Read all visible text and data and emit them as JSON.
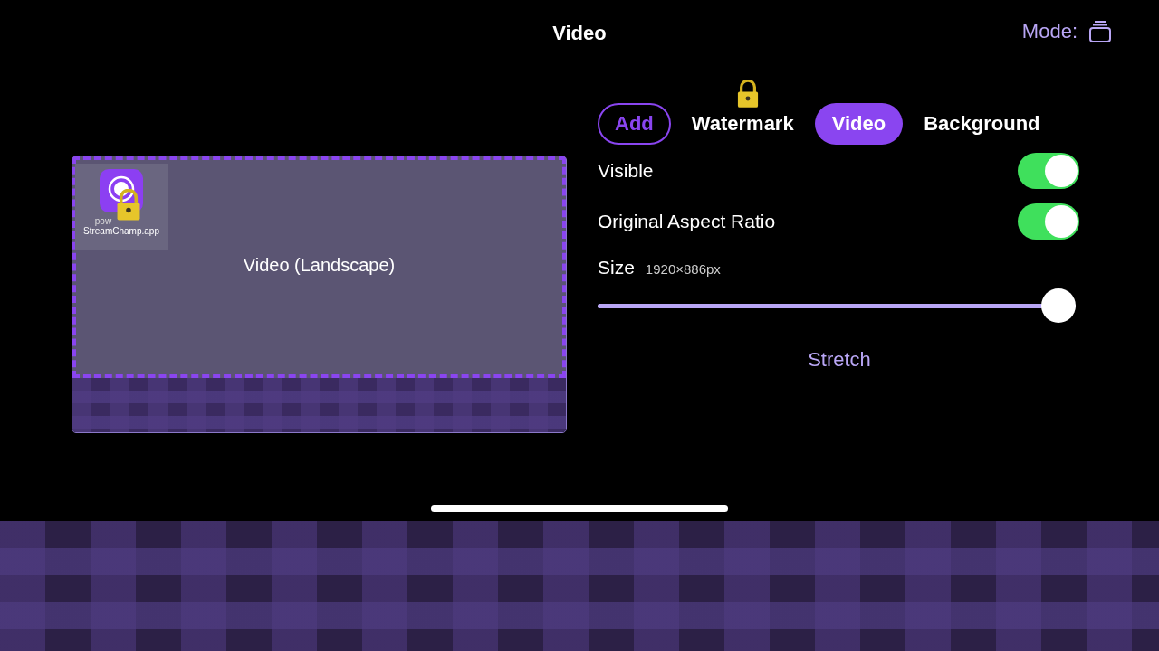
{
  "header": {
    "title": "Video",
    "mode_label": "Mode:"
  },
  "preview": {
    "label": "Video (Landscape)",
    "watermark": {
      "caption_start": "pow",
      "caption_end": "StreamChamp.app",
      "locked": true
    }
  },
  "tabs": [
    {
      "label": "Add",
      "kind": "outline",
      "selected": false,
      "locked": false
    },
    {
      "label": "Watermark",
      "kind": "plain",
      "selected": false,
      "locked": true
    },
    {
      "label": "Video",
      "kind": "plain",
      "selected": true,
      "locked": false
    },
    {
      "label": "Background",
      "kind": "plain",
      "selected": false,
      "locked": false
    }
  ],
  "settings": [
    {
      "label": "Visible",
      "on": true
    },
    {
      "label": "Original Aspect Ratio",
      "on": true
    }
  ],
  "size": {
    "label": "Size",
    "reading": "1920×886px",
    "level": 1.0
  },
  "stretch_button": "Stretch"
}
